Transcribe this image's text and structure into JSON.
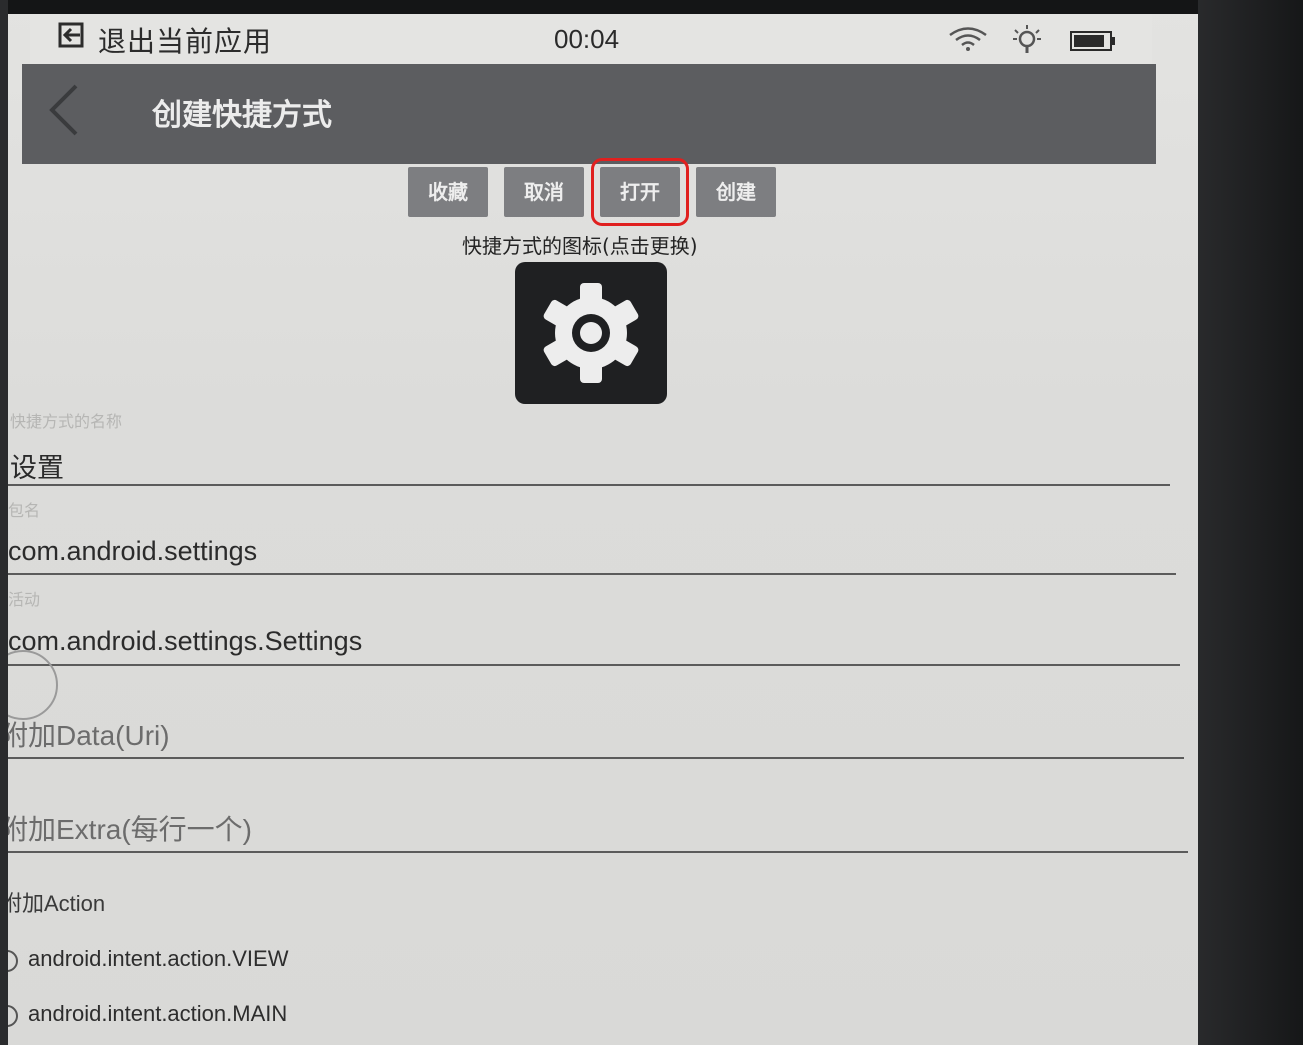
{
  "status_bar": {
    "exit_label": "退出当前应用",
    "time": "00:04"
  },
  "app_bar": {
    "title": "创建快捷方式"
  },
  "actions": {
    "favorite": "收藏",
    "cancel": "取消",
    "open": "打开",
    "create": "创建"
  },
  "icon_section": {
    "caption": "快捷方式的图标(点击更换)"
  },
  "form": {
    "name_label": "快捷方式的名称",
    "name_value": "设置",
    "package_label": "包名",
    "package_value": "com.android.settings",
    "activity_label": "活动",
    "activity_value": "com.android.settings.Settings",
    "data_placeholder": "附加Data(Uri)",
    "extra_placeholder": "附加Extra(每行一个)",
    "action_label": "附加Action",
    "action_options": [
      "android.intent.action.VIEW",
      "android.intent.action.MAIN"
    ]
  },
  "colors": {
    "app_bar": "#5c5d60",
    "button": "#7d7e81",
    "highlight": "#e0201f"
  }
}
